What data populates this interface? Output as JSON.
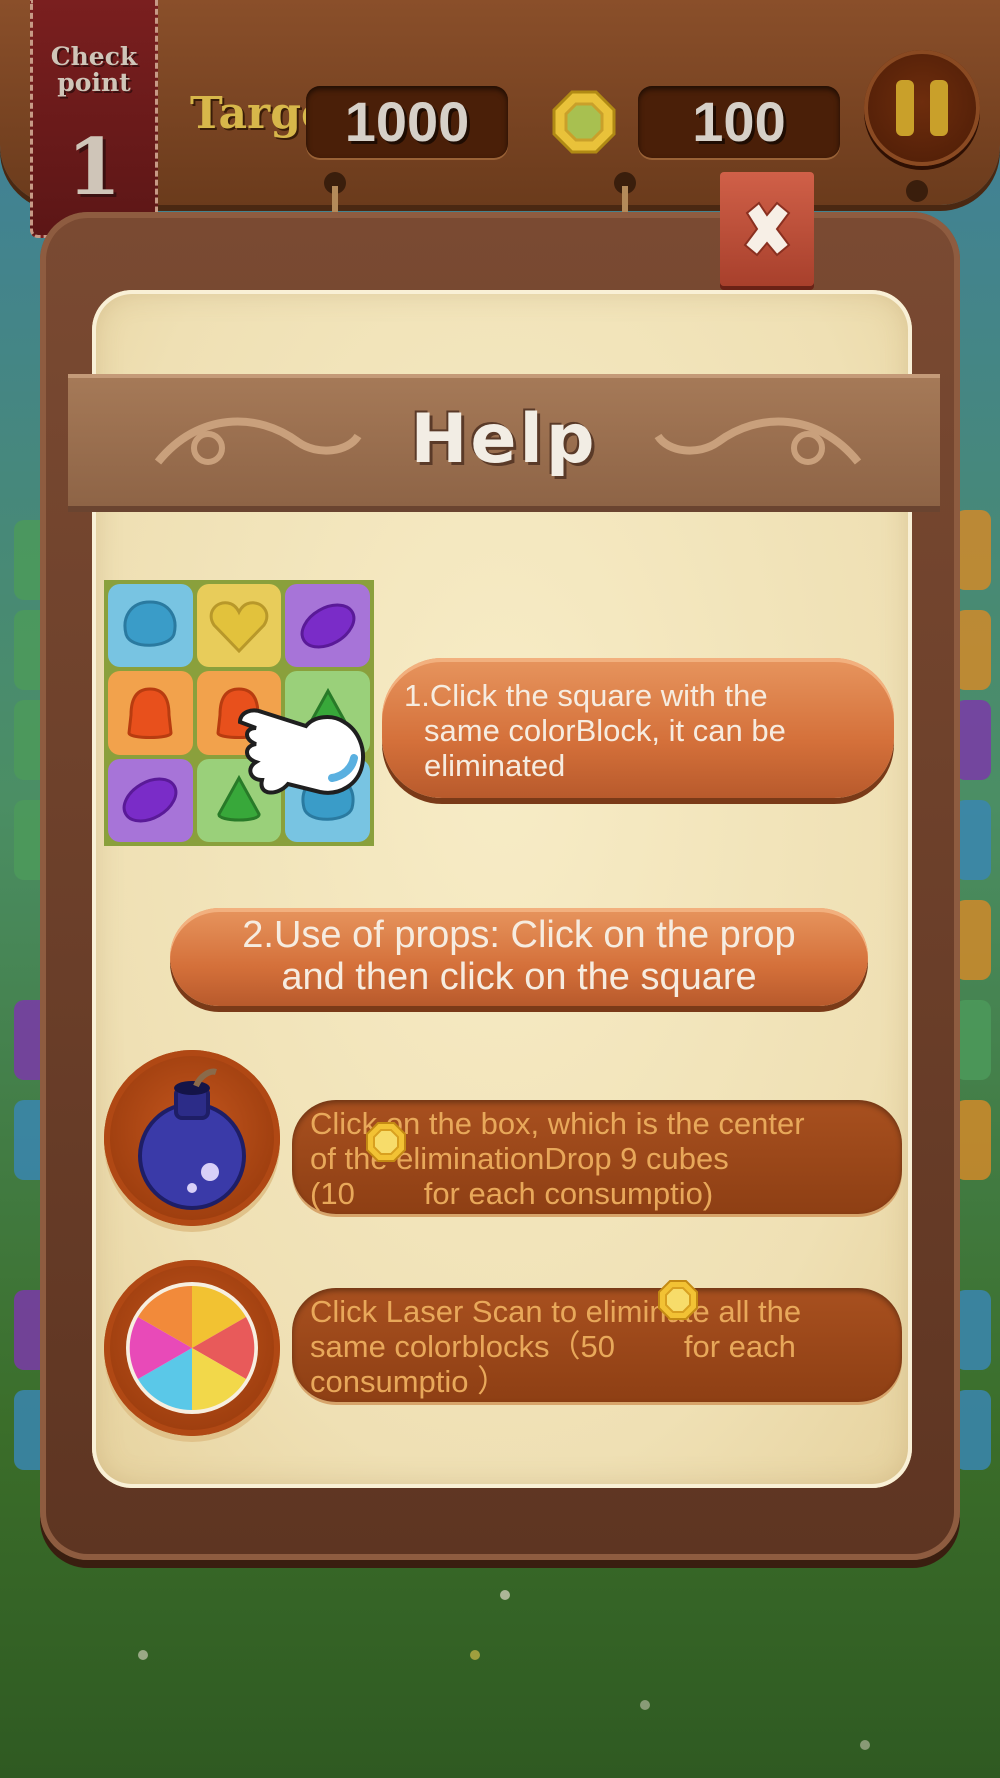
{
  "header": {
    "checkpoint_label": "Check point",
    "checkpoint_number": "1",
    "target_label": "Target",
    "target_value": "1000",
    "coins_value": "100"
  },
  "icons": {
    "coin": "coin-icon",
    "pause": "pause-icon",
    "close": "close-icon",
    "bomb": "bomb-icon",
    "laser": "color-wheel-icon",
    "hand": "pointing-hand-icon"
  },
  "help": {
    "title": "Help",
    "step1": [
      "1.Click the square with the",
      "same colorBlock, it can be",
      "eliminated"
    ],
    "step2": [
      "2.Use of props: Click on the prop",
      "and then click on the square"
    ],
    "bomb_desc": [
      "Click on the box, which is the center",
      "of the eliminationDrop 9 cubes",
      "(10        for each consumptio)"
    ],
    "laser_desc": [
      "Click Laser Scan to eliminate all the",
      "same colorblocks（50        for each",
      "consumptio ）"
    ]
  },
  "colors": {
    "wood_dark": "#5e3522",
    "paper": "#f3e6bd",
    "plank": "#d4703a",
    "pill": "#9a4818",
    "pill_text": "#e8a85a",
    "gold": "#c9a02a"
  },
  "tiles": [
    "blue",
    "yellow",
    "purple",
    "orange",
    "orange",
    "green",
    "purple",
    "green",
    "blue"
  ]
}
